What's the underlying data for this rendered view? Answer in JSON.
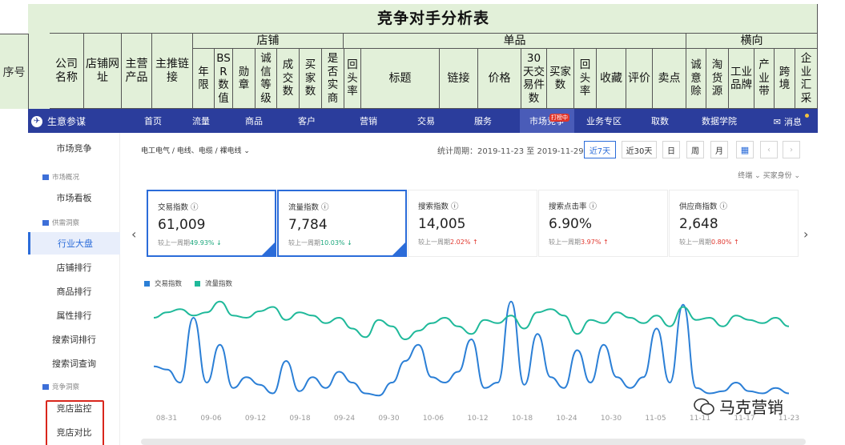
{
  "sheet": {
    "title": "竞争对手分析表",
    "col_seq": "序号",
    "col_company": "公司名称",
    "col_shop_url": "店铺网址",
    "col_main_product": "主营产品",
    "col_main_link": "主推链接",
    "group_shop": "店铺",
    "shop_cols": [
      "年限",
      "BSR数值",
      "勋章",
      "诚信等级",
      "成交数",
      "买家数",
      "是否实商",
      "回头率"
    ],
    "group_item": "单品",
    "item_cols": [
      "标题",
      "链接",
      "价格",
      "30天交易件数",
      "买家数",
      "回头率",
      "收藏",
      "评价",
      "卖点"
    ],
    "group_horizontal": "横向",
    "horizontal_cols": [
      "诚意赊",
      "淘货源",
      "工业品牌",
      "产业带",
      "跨境",
      "企业汇采"
    ]
  },
  "nav": {
    "brand": "生意参谋",
    "items": [
      "首页",
      "流量",
      "商品",
      "客户",
      "营销",
      "交易",
      "服务",
      "市场竞争",
      "业务专区",
      "取数",
      "数据学院"
    ],
    "active_index": 7,
    "badge": "打榜中",
    "message": "消息"
  },
  "sidebar": {
    "top": "市场竞争",
    "section1": "市场概况",
    "s1_items": [
      "市场看板"
    ],
    "section2": "供需洞察",
    "s2_items": [
      "行业大盘",
      "店铺排行",
      "商品排行",
      "属性排行",
      "搜索词排行",
      "搜索词查询"
    ],
    "active": "行业大盘",
    "section3": "竞争洞察",
    "s3_items": [
      "竞店监控",
      "竞店对比"
    ]
  },
  "filters": {
    "category": "电工电气 / 电线、电缆 / 裸电线",
    "period_label": "统计周期：2019-11-23 至 2019-11-29",
    "buttons": [
      "近7天",
      "近30天",
      "日",
      "周",
      "月"
    ],
    "active_button": "近7天",
    "terminal": "终端",
    "buyer_identity": "买家身份"
  },
  "cards": [
    {
      "label": "交易指数",
      "value": "61,009",
      "compare": "较上一周期",
      "change": "49.93%",
      "dir": "down",
      "selected": true
    },
    {
      "label": "流量指数",
      "value": "7,784",
      "compare": "较上一周期",
      "change": "10.03%",
      "dir": "down",
      "selected": true
    },
    {
      "label": "搜索指数",
      "value": "14,005",
      "compare": "较上一周期",
      "change": "2.02%",
      "dir": "up",
      "selected": false
    },
    {
      "label": "搜索点击率",
      "value": "6.90%",
      "compare": "较上一周期",
      "change": "3.97%",
      "dir": "up",
      "selected": false
    },
    {
      "label": "供应商指数",
      "value": "2,648",
      "compare": "较上一周期",
      "change": "0.80%",
      "dir": "up",
      "selected": false
    }
  ],
  "chart_data": {
    "type": "line",
    "x": [
      "08-31",
      "09-06",
      "09-12",
      "09-18",
      "09-24",
      "09-30",
      "10-06",
      "10-12",
      "10-18",
      "10-24",
      "10-30",
      "11-05",
      "11-11",
      "11-17",
      "11-23"
    ],
    "series": [
      {
        "name": "交易指数",
        "color": "#2b7fd6",
        "values": [
          35,
          32,
          20,
          80,
          20,
          55,
          15,
          25,
          18,
          10,
          40,
          12,
          25,
          15,
          30,
          20,
          10,
          8,
          20,
          40,
          55,
          25,
          20,
          30,
          60,
          15,
          20,
          95,
          18,
          65,
          25,
          15,
          50,
          20,
          55,
          25,
          15,
          25,
          70,
          20,
          92,
          15,
          10,
          12,
          20,
          12,
          10,
          15,
          10
        ]
      },
      {
        "name": "流量指数",
        "color": "#1fb99a",
        "values": [
          80,
          85,
          88,
          82,
          85,
          95,
          82,
          80,
          86,
          90,
          78,
          85,
          82,
          75,
          80,
          70,
          62,
          78,
          72,
          60,
          68,
          75,
          80,
          72,
          65,
          78,
          75,
          82,
          70,
          85,
          88,
          82,
          65,
          78,
          75,
          85,
          80,
          75,
          82,
          72,
          90,
          78,
          80,
          72,
          82,
          78,
          75,
          80,
          72
        ]
      }
    ]
  },
  "watermark": "马克营销"
}
